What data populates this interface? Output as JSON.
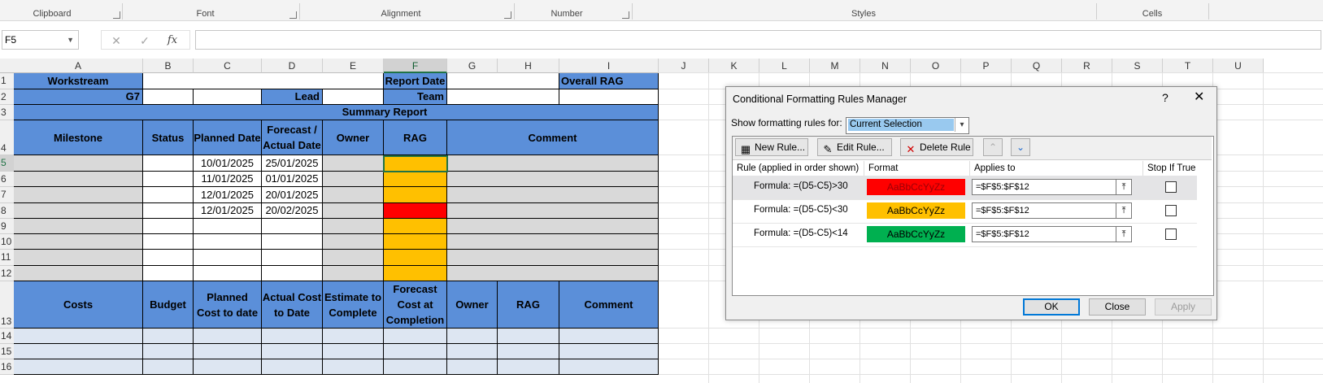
{
  "ribbon": {
    "groups": [
      "Clipboard",
      "Font",
      "Alignment",
      "Number",
      "Styles",
      "Cells"
    ]
  },
  "formula_bar": {
    "name_box": "F5",
    "cancel_icon": "✕",
    "enter_icon": "✓",
    "fx_label": "fx",
    "formula": ""
  },
  "columns": [
    "A",
    "B",
    "C",
    "D",
    "E",
    "F",
    "G",
    "H",
    "I",
    "J",
    "K",
    "L",
    "M",
    "N",
    "O",
    "P",
    "Q",
    "R",
    "S",
    "T",
    "U"
  ],
  "rows": [
    "1",
    "2",
    "3",
    "4",
    "5",
    "6",
    "7",
    "8",
    "9",
    "10",
    "11",
    "12",
    "13",
    "14",
    "15",
    "16"
  ],
  "sheet": {
    "workstream": "Workstream",
    "g7": "G7",
    "lead": "Lead",
    "report_date": "Report Date",
    "team": "Team",
    "overall_rag": "Overall RAG",
    "summary_report": "Summary Report",
    "milestone_headers": [
      "Milestone",
      "Status",
      "Planned Date",
      "Forecast / Actual Date",
      "Owner",
      "RAG",
      "Comment"
    ],
    "milestone_rows": [
      {
        "planned": "10/01/2025",
        "forecast": "25/01/2025",
        "rag": "amber"
      },
      {
        "planned": "11/01/2025",
        "forecast": "01/01/2025",
        "rag": "amber"
      },
      {
        "planned": "12/01/2025",
        "forecast": "20/01/2025",
        "rag": "amber"
      },
      {
        "planned": "12/01/2025",
        "forecast": "20/02/2025",
        "rag": "red"
      },
      {
        "planned": "",
        "forecast": "",
        "rag": "amber"
      },
      {
        "planned": "",
        "forecast": "",
        "rag": "amber"
      },
      {
        "planned": "",
        "forecast": "",
        "rag": "amber"
      },
      {
        "planned": "",
        "forecast": "",
        "rag": "amber"
      }
    ],
    "cost_headers": [
      "Costs",
      "Budget",
      "Planned Cost to date",
      "Actual Cost to Date",
      "Estimate to Complete",
      "Forecast Cost at Completion",
      "Owner",
      "RAG",
      "Comment"
    ]
  },
  "dialog": {
    "title": "Conditional Formatting Rules Manager",
    "help": "?",
    "close": "✕",
    "show_label": "Show formatting rules for:",
    "show_value": "Current Selection",
    "buttons": {
      "new_rule": "New Rule...",
      "edit_rule": "Edit Rule...",
      "delete_rule": "Delete Rule"
    },
    "table_headers": [
      "Rule (applied in order shown)",
      "Format",
      "Applies to",
      "Stop If True"
    ],
    "rules": [
      {
        "formula": "Formula: =(D5-C5)>30",
        "sample": "AaBbCcYyZz",
        "color": "#ff0000",
        "text_color": "#9c0006",
        "applies": "=$F$5:$F$12",
        "stop": false
      },
      {
        "formula": "Formula: =(D5-C5)<30",
        "sample": "AaBbCcYyZz",
        "color": "#ffc000",
        "text_color": "#000000",
        "applies": "=$F$5:$F$12",
        "stop": false
      },
      {
        "formula": "Formula: =(D5-C5)<14",
        "sample": "AaBbCcYyZz",
        "color": "#00b050",
        "text_color": "#000000",
        "applies": "=$F$5:$F$12",
        "stop": false
      }
    ],
    "ok": "OK",
    "close_btn": "Close",
    "apply": "Apply"
  }
}
